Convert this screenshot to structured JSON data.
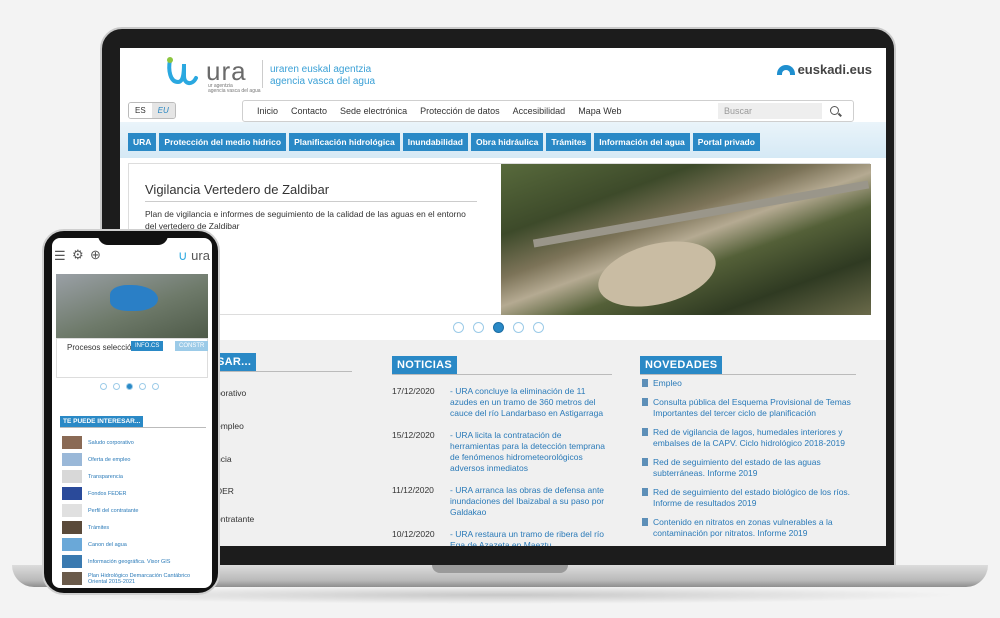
{
  "header": {
    "logo_text": "ura",
    "logo_sub_1": "ur agentzia",
    "logo_sub_2": "agencia vasca del agua",
    "agency_line_1": "uraren euskal agentzia",
    "agency_line_2": "agencia vasca del agua",
    "gov_brand": "euskadi.eus"
  },
  "lang": {
    "es": "ES",
    "eu": "EU"
  },
  "utility_nav": [
    "Inicio",
    "Contacto",
    "Sede electrónica",
    "Protección de datos",
    "Accesibilidad",
    "Mapa Web"
  ],
  "search": {
    "placeholder": "Buscar"
  },
  "main_nav": [
    "URA",
    "Protección del medio hídrico",
    "Planificación hidrológica",
    "Inundabilidad",
    "Obra hidráulica",
    "Trámites",
    "Información del agua",
    "Portal privado"
  ],
  "slide": {
    "title": "Vigilancia Vertedero de Zaldibar",
    "text": "Plan de vigilancia e informes de seguimiento de la calidad de las aguas en el entorno del vertedero de Zaldibar",
    "active_index": 2,
    "count": 5
  },
  "left_section": {
    "heading_fragment": "SAR...",
    "items": [
      "porativo",
      "empleo",
      "ncia",
      "DER",
      "ontratante"
    ]
  },
  "news": {
    "heading": "NOTICIAS",
    "items": [
      {
        "date": "17/12/2020",
        "text": "- URA concluye la eliminación de 11 azudes en un tramo de 360 metros del cauce del río Landarbaso en Astigarraga"
      },
      {
        "date": "15/12/2020",
        "text": "- URA licita la contratación de herramientas para la detección temprana de fenómenos hidrometeorológicos adversos inmediatos"
      },
      {
        "date": "11/12/2020",
        "text": "- URA arranca las obras de defensa ante inundaciones del Ibaizabal a su paso por Galdakao"
      },
      {
        "date": "10/12/2020",
        "text": "- URA restaura un tramo de ribera del río Ega de Azazeta en Maeztu"
      }
    ]
  },
  "novedades": {
    "heading": "NOVEDADES",
    "items": [
      "Empleo",
      "Consulta pública del Esquema Provisional de Temas Importantes del tercer ciclo de planificación",
      "Red de vigilancia de lagos, humedales interiores y embalses de la CAPV. Ciclo hidrológico 2018-2019",
      "Red de seguimiento del estado de las aguas subterráneas. Informe 2019",
      "Red de seguimiento del estado biológico de los ríos. Informe de resultados 2019",
      "Contenido en nitratos en zonas vulnerables a la contaminación por nitratos. Informe 2019"
    ]
  },
  "mobile": {
    "logo_text": "ura",
    "slide_caption": "Procesos selección",
    "btn_1": "INFO.CS",
    "btn_2": "CONSTR",
    "section_heading": "TE PUEDE INTERESAR...",
    "items": [
      {
        "label": "Saludo corporativo",
        "thumb_color": "#8a6a55"
      },
      {
        "label": "Oferta de empleo",
        "thumb_color": "#9ab8d8"
      },
      {
        "label": "Transparencia",
        "thumb_color": "#d8d8d8"
      },
      {
        "label": "Fondos FEDER",
        "thumb_color": "#2a4a9a"
      },
      {
        "label": "Perfil del contratante",
        "thumb_color": "#e0e0e0"
      },
      {
        "label": "Trámites",
        "thumb_color": "#5a4a3a"
      },
      {
        "label": "Canon del agua",
        "thumb_color": "#6aa8d8"
      },
      {
        "label": "Información geográfica. Visor GIS",
        "thumb_color": "#3a7ab0"
      },
      {
        "label": "Plan Hidrológico Demarcación Cantábrico Oriental 2015-2021",
        "thumb_color": "#6a5a4a"
      }
    ]
  },
  "colors": {
    "accent": "#2a89c6",
    "link": "#2a7ab8"
  }
}
